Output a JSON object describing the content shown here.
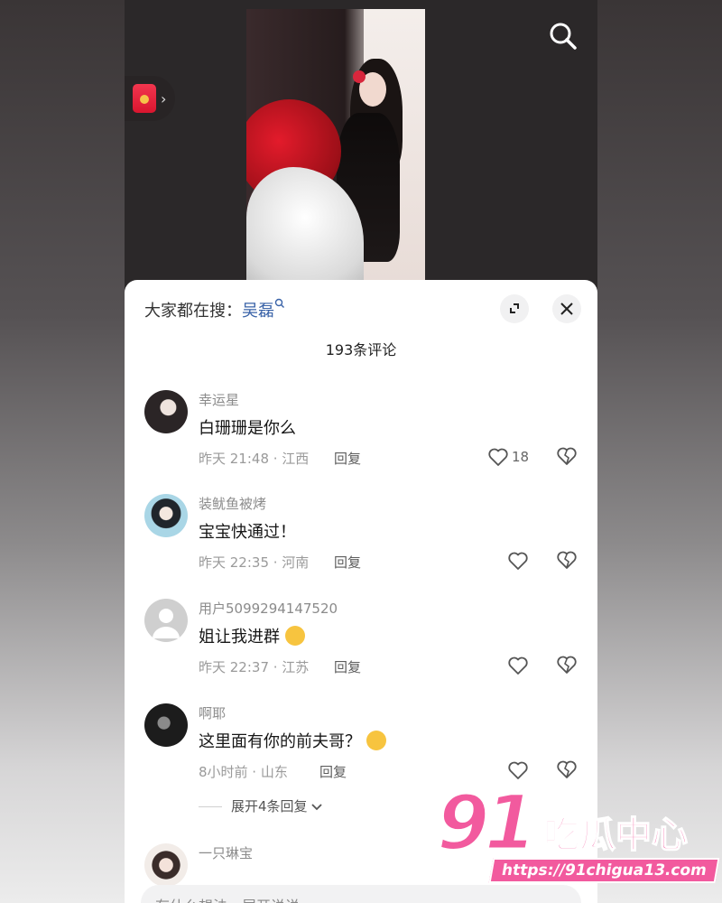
{
  "header": {
    "hot_search_prefix": "大家都在搜：",
    "hot_search_keyword": "吴磊",
    "comment_count": "193条评论"
  },
  "comments": [
    {
      "user": "幸运星",
      "text": "白珊珊是你么",
      "meta": "昨天 21:48 · 江西",
      "reply": "回复",
      "likes": "18"
    },
    {
      "user": "装鱿鱼被烤",
      "text": "宝宝快通过！",
      "meta": "昨天 22:35 · 河南",
      "reply": "回复",
      "likes": ""
    },
    {
      "user": "用户5099294147520",
      "text": "姐让我进群",
      "meta": "昨天 22:37 · 江苏",
      "reply": "回复",
      "likes": ""
    },
    {
      "user": "啊耶",
      "text": "这里面有你的前夫哥？",
      "meta": "8小时前 · 山东",
      "reply": "回复",
      "likes": ""
    },
    {
      "user": "一只琳宝",
      "text": "",
      "meta": "",
      "reply": "",
      "likes": ""
    }
  ],
  "expand_replies": "展开4条回复",
  "input": {
    "placeholder": "有什么想法，展开说说"
  },
  "watermark": {
    "brand_number": "91",
    "brand_name": "吃瓜中心",
    "url": "https://91chigua13.com"
  },
  "icons": [
    "search-icon",
    "red-packet-icon",
    "collapse-icon",
    "close-icon",
    "heart-icon",
    "broken-heart-icon",
    "image-icon",
    "at-icon",
    "emoji-icon"
  ],
  "colors": {
    "keyword": "#3a63a8",
    "watermark": "#f25a9e"
  }
}
